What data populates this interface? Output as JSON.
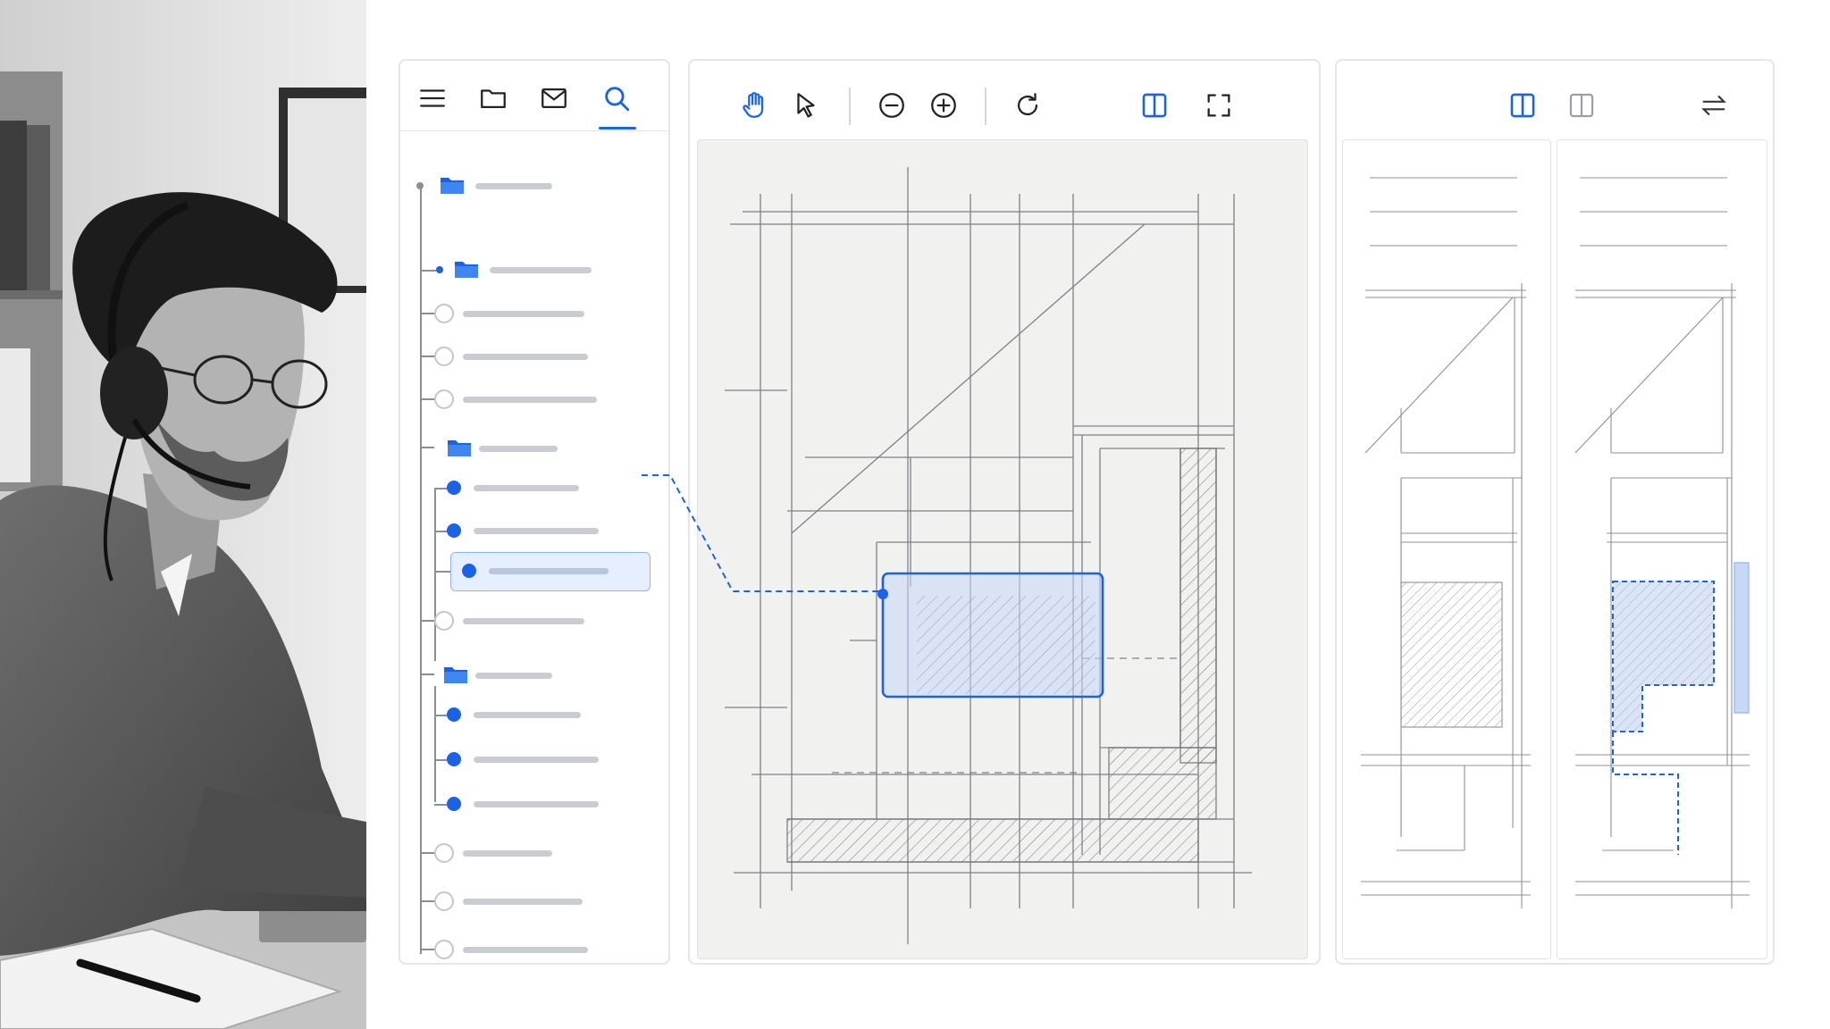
{
  "colors": {
    "accent": "#1a63e8",
    "border": "#e3e5e8",
    "placeholder_bar": "#c9ccd1",
    "sketch": "#6a6e74"
  },
  "photo": {
    "description_icon": "person-with-headset-photo"
  },
  "sidebar": {
    "tabs": [
      {
        "icon": "menu-icon",
        "active": false
      },
      {
        "icon": "folder-icon",
        "active": false
      },
      {
        "icon": "mail-icon",
        "active": false
      },
      {
        "icon": "search-icon",
        "active": true
      }
    ],
    "tree": {
      "selected_item_icon": "bullet-icon",
      "folders": [
        "folder-icon",
        "folder-icon",
        "folder-icon",
        "folder-icon"
      ]
    }
  },
  "viewer_toolbar": {
    "tools": [
      "hand-icon",
      "pointer-icon",
      "zoom-out-icon",
      "zoom-in-icon",
      "rotate-icon",
      "split-view-icon",
      "fullscreen-icon"
    ],
    "active_tools": [
      "hand-icon",
      "split-view-icon"
    ]
  },
  "compare_toolbar": {
    "tools": [
      "split-view-icon",
      "single-view-icon",
      "swap-icon"
    ],
    "active_tools": [
      "split-view-icon"
    ]
  }
}
